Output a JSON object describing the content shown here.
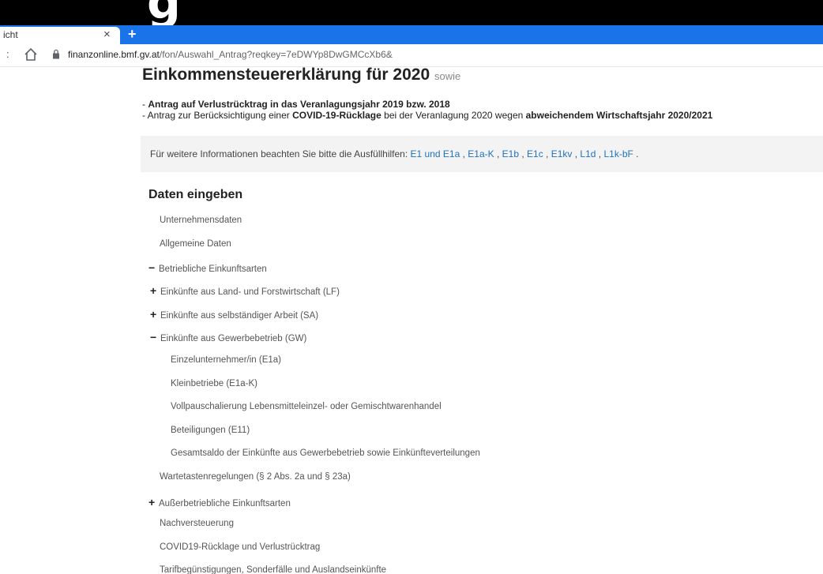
{
  "browser": {
    "cropped_heading_glyph": "g",
    "tab_title": "icht",
    "tab_close": "×",
    "new_tab": "+",
    "url_host": "finanzonline.bmf.gv.at",
    "url_path": "/fon/Auswahl_Antrag?reqkey=7eDWYp8DwGMCcXb6&",
    "nav_forward_symbol": ":",
    "icons": [
      "home-icon",
      "lock-icon"
    ]
  },
  "page": {
    "title": "Einkommensteuererklärung für 2020",
    "title_suffix": "sowie",
    "desc1": {
      "prefix": "- ",
      "bold": "Antrag auf Verlustrücktrag in das Veranlagungsjahr 2019 bzw. 2018"
    },
    "desc2": {
      "part1": "- Antrag zur Berücksichtigung einer ",
      "bold1": "COVID-19-Rücklage",
      "part2": " bei der Veranlagung 2020 wegen ",
      "bold2": "abweichendem Wirtschaftsjahr 2020/2021"
    },
    "info": {
      "text": "Für weitere Informationen beachten Sie bitte die Ausfüllhilfen: ",
      "links": [
        "E1 und E1a",
        "E1a-K",
        "E1b",
        "E1c",
        "E1kv",
        "L1d",
        "L1k-bF"
      ],
      "separator": " , ",
      "end": " ."
    },
    "section_title": "Daten eingeben",
    "nav": [
      {
        "label": "Unternehmensdaten",
        "symbol": ""
      },
      {
        "label": "Allgemeine Daten",
        "symbol": ""
      },
      {
        "label": "Betriebliche Einkunftsarten",
        "symbol": "−"
      },
      {
        "label": "Einkünfte aus Land- und Forstwirtschaft (LF)",
        "symbol": "+"
      },
      {
        "label": "Einkünfte aus selbständiger Arbeit (SA)",
        "symbol": "+"
      },
      {
        "label": "Einkünfte aus Gewerbebetrieb (GW)",
        "symbol": "−"
      },
      {
        "label": "Einzelunternehmer/in (E1a)",
        "symbol": ""
      },
      {
        "label": "Kleinbetriebe (E1a-K)",
        "symbol": ""
      },
      {
        "label": "Vollpauschalierung Lebensmitteleinzel- oder Gemischtwarenhandel",
        "symbol": ""
      },
      {
        "label": "Beteiligungen (E11)",
        "symbol": ""
      },
      {
        "label": "Gesamtsaldo der Einkünfte aus Gewerbebetrieb sowie Einkünfteverteilungen",
        "symbol": ""
      },
      {
        "label": "Wartetastenregelungen (§ 2 Abs. 2a und § 23a)",
        "symbol": ""
      },
      {
        "label": "Außerbetriebliche Einkunftsarten",
        "symbol": "+"
      },
      {
        "label": "Nachversteuerung",
        "symbol": ""
      },
      {
        "label": "COVID19-Rücklage und Verlustrücktrag",
        "symbol": ""
      },
      {
        "label": "Tarifbegünstigungen, Sonderfälle und Auslandseinkünfte",
        "symbol": ""
      }
    ]
  },
  "colors": {
    "tabstrip": "#1a73e8",
    "link": "#1e73be",
    "infobox_bg": "#f3f3f3"
  }
}
